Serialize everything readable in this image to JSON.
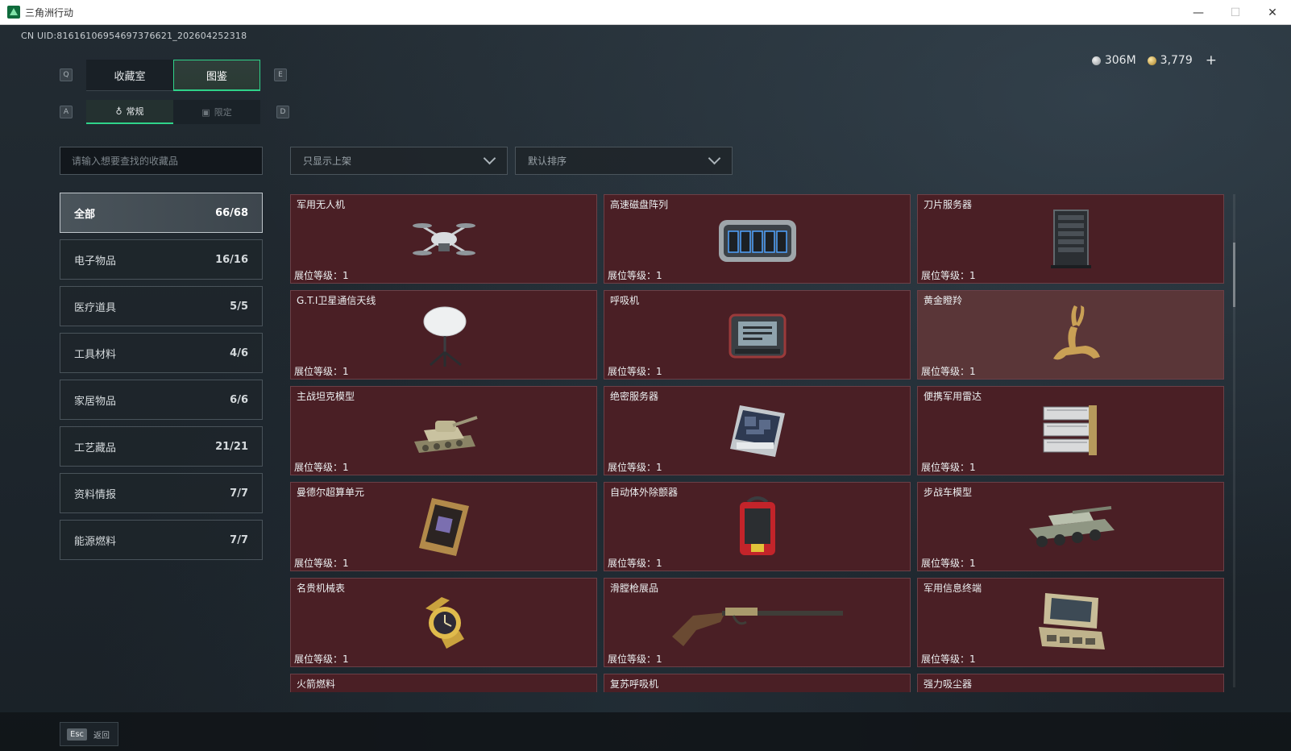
{
  "window": {
    "title": "三角洲行动",
    "controls": [
      "—",
      "☐",
      "✕"
    ]
  },
  "uid": "CN UID:8161610695469737662​1_202604252318",
  "currency": {
    "silver": "306M",
    "gold": "3,779",
    "add": "+"
  },
  "keys": {
    "left_main": "Q",
    "right_main": "E",
    "left_sub": "A",
    "right_sub": "D"
  },
  "tabs_main": [
    {
      "label": "收藏室"
    },
    {
      "label": "图鉴"
    }
  ],
  "tabs_sub": [
    {
      "label": "常规"
    },
    {
      "label": "限定"
    }
  ],
  "search": {
    "placeholder": "请输入想要查找的收藏品"
  },
  "filters": {
    "shelf": "只显示上架",
    "sort": "默认排序"
  },
  "categories": [
    {
      "label": "全部",
      "count": "66/68"
    },
    {
      "label": "电子物品",
      "count": "16/16"
    },
    {
      "label": "医疗道具",
      "count": "5/5"
    },
    {
      "label": "工具材料",
      "count": "4/6"
    },
    {
      "label": "家居物品",
      "count": "6/6"
    },
    {
      "label": "工艺藏品",
      "count": "21/21"
    },
    {
      "label": "资料情报",
      "count": "7/7"
    },
    {
      "label": "能源燃料",
      "count": "7/7"
    }
  ],
  "items": [
    {
      "name": "军用无人机",
      "level": "展位等级：1",
      "icon": "drone-icon"
    },
    {
      "name": "高速磁盘阵列",
      "level": "展位等级：1",
      "icon": "disk-array-icon"
    },
    {
      "name": "刀片服务器",
      "level": "展位等级：1",
      "icon": "blade-server-icon"
    },
    {
      "name": "G.T.I卫星通信天线",
      "level": "展位等级：1",
      "icon": "satellite-antenna-icon"
    },
    {
      "name": "呼吸机",
      "level": "展位等级：1",
      "icon": "ventilator-icon"
    },
    {
      "name": "黄金瞪羚",
      "level": "展位等级：1",
      "icon": "golden-gazelle-icon"
    },
    {
      "name": "主战坦克模型",
      "level": "展位等级：1",
      "icon": "tank-model-icon"
    },
    {
      "name": "绝密服务器",
      "level": "展位等级：1",
      "icon": "secret-server-icon"
    },
    {
      "name": "便携军用雷达",
      "level": "展位等级：1",
      "icon": "radar-icon"
    },
    {
      "name": "曼德尔超算单元",
      "level": "展位等级：1",
      "icon": "supercomputer-unit-icon"
    },
    {
      "name": "自动体外除颤器",
      "level": "展位等级：1",
      "icon": "defibrillator-icon"
    },
    {
      "name": "步战车模型",
      "level": "展位等级：1",
      "icon": "ifv-model-icon"
    },
    {
      "name": "名贵机械表",
      "level": "展位等级：1",
      "icon": "watch-icon"
    },
    {
      "name": "滑膛枪展品",
      "level": "展位等级：1",
      "icon": "musket-icon"
    },
    {
      "name": "军用信息终端",
      "level": "展位等级：1",
      "icon": "terminal-icon"
    },
    {
      "name": "火箭燃料",
      "level": "",
      "icon": ""
    },
    {
      "name": "复苏呼吸机",
      "level": "",
      "icon": ""
    },
    {
      "name": "强力吸尘器",
      "level": "",
      "icon": ""
    }
  ],
  "back": {
    "key": "Esc",
    "label": "返回"
  }
}
